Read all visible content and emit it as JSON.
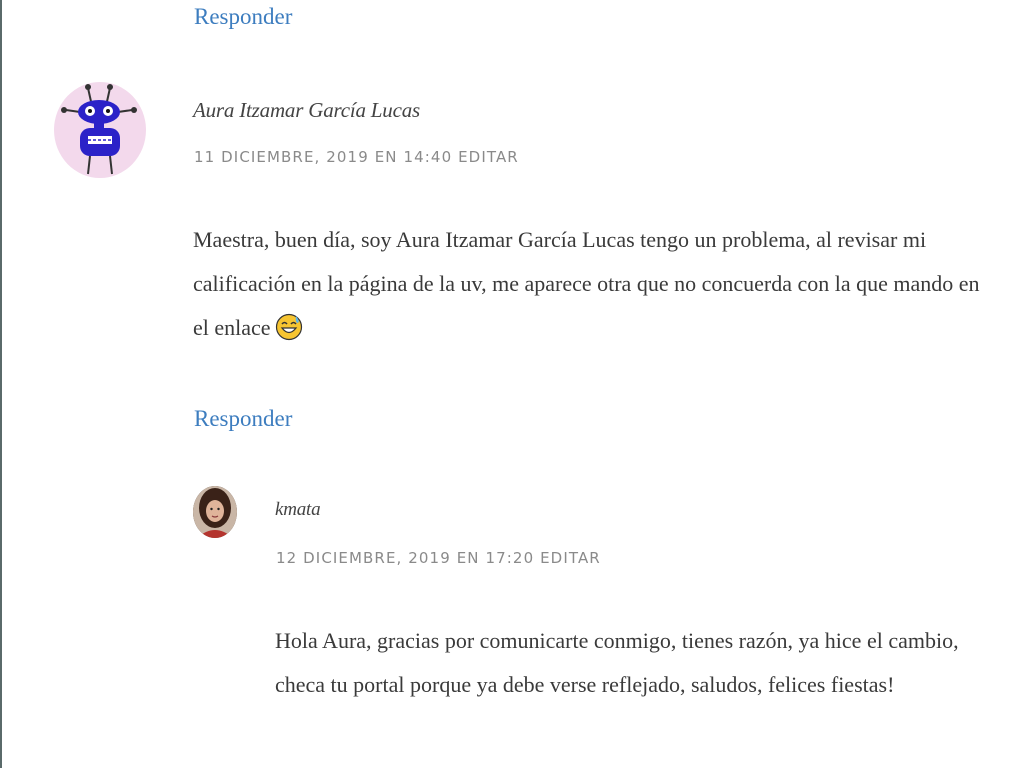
{
  "comments": [
    {
      "reply_label": "Responder"
    },
    {
      "author": "Aura Itzamar García Lucas",
      "date": "11 DICIEMBRE, 2019 EN 14:40",
      "edit_label": "EDITAR",
      "text": "Maestra, buen día, soy Aura Itzamar García Lucas tengo un problema, al revisar mi calificación en la página de la uv, me aparece otra que no concuerda con la que mando en el enlace",
      "emoji": "grinning-sweat-emoji",
      "reply_label": "Responder",
      "avatar": "monster-avatar-icon"
    },
    {
      "author": "kmata",
      "date": "12 DICIEMBRE, 2019 EN 17:20",
      "edit_label": "EDITAR",
      "text": "Hola Aura, gracias por comunicarte conmigo, tienes razón, ya hice el cambio, checa tu portal porque ya debe verse reflejado, saludos, felices fiestas!",
      "avatar": "profile-photo-avatar"
    }
  ],
  "colors": {
    "link": "#3d7dbf",
    "meta": "#8a8a8a",
    "text": "#3a3a3a",
    "avatar_bg": "#f3d9ec",
    "monster": "#2b22c8"
  }
}
